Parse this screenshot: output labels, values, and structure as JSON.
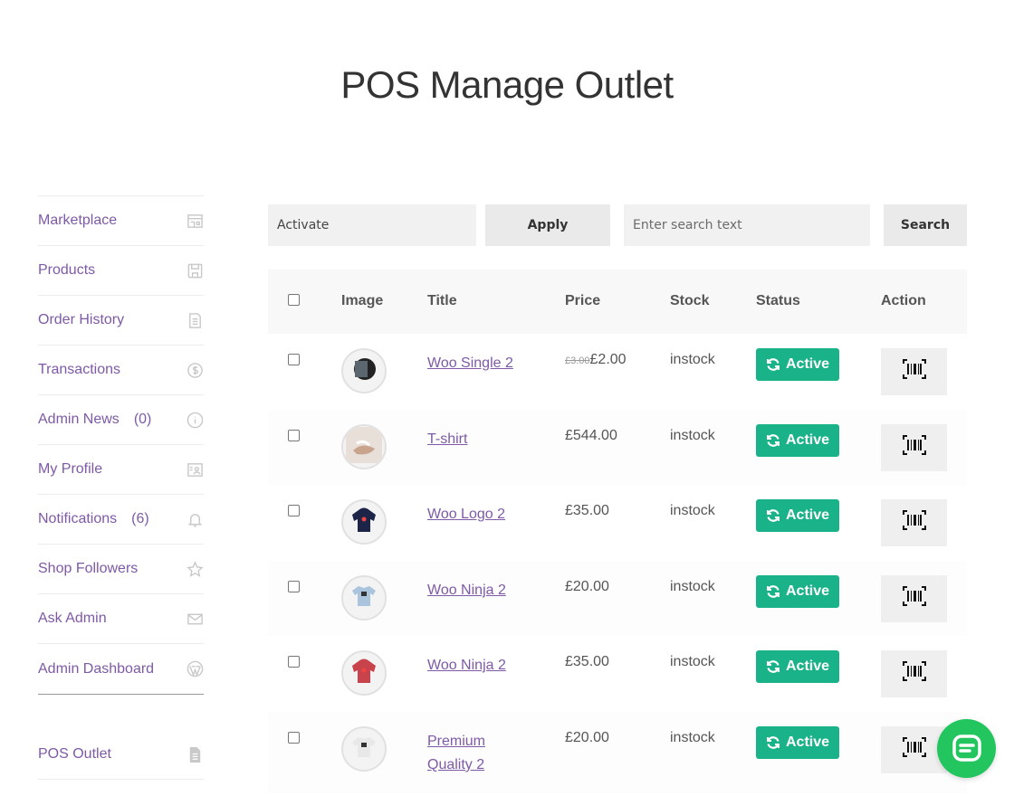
{
  "page": {
    "title": "POS Manage Outlet"
  },
  "sidebar": {
    "items": [
      {
        "label": "Marketplace",
        "count": "",
        "icon": "store-icon"
      },
      {
        "label": "Products",
        "count": "",
        "icon": "save-icon"
      },
      {
        "label": "Order History",
        "count": "",
        "icon": "document-icon"
      },
      {
        "label": "Transactions",
        "count": "",
        "icon": "dollar-icon"
      },
      {
        "label": "Admin News",
        "count": "(0)",
        "icon": "info-icon"
      },
      {
        "label": "My Profile",
        "count": "",
        "icon": "profile-card-icon"
      },
      {
        "label": "Notifications",
        "count": "(6)",
        "icon": "bell-icon"
      },
      {
        "label": "Shop Followers",
        "count": "",
        "icon": "star-icon"
      },
      {
        "label": "Ask Admin",
        "count": "",
        "icon": "mail-icon"
      },
      {
        "label": "Admin Dashboard",
        "count": "",
        "icon": "wordpress-icon"
      }
    ],
    "pos_items": [
      {
        "label": "POS Outlet",
        "icon": "file-icon"
      }
    ]
  },
  "toolbar": {
    "bulk_action_value": "Activate",
    "apply_label": "Apply",
    "search_placeholder": "Enter search text",
    "search_label": "Search"
  },
  "table": {
    "headers": {
      "image": "Image",
      "title": "Title",
      "price": "Price",
      "stock": "Stock",
      "status": "Status",
      "action": "Action"
    },
    "rows": [
      {
        "title": [
          "Woo Single 2"
        ],
        "old_price": "£3.00",
        "price": "£2.00",
        "stock": "instock",
        "status": "Active",
        "thumb": "album-icon"
      },
      {
        "title": [
          "T-shirt"
        ],
        "old_price": "",
        "price": "£544.00",
        "stock": "instock",
        "status": "Active",
        "thumb": "hand-icon"
      },
      {
        "title": [
          "Woo Logo 2"
        ],
        "old_price": "",
        "price": "£35.00",
        "stock": "instock",
        "status": "Active",
        "thumb": "hoodie-icon"
      },
      {
        "title": [
          "Woo Ninja 2"
        ],
        "old_price": "",
        "price": "£20.00",
        "stock": "instock",
        "status": "Active",
        "thumb": "tshirt-icon"
      },
      {
        "title": [
          "Woo Ninja 2"
        ],
        "old_price": "",
        "price": "£35.00",
        "stock": "instock",
        "status": "Active",
        "thumb": "hoodie-icon"
      },
      {
        "title": [
          "Premium",
          "Quality 2"
        ],
        "old_price": "",
        "price": "£20.00",
        "stock": "instock",
        "status": "Active",
        "thumb": "tshirt-icon"
      }
    ]
  },
  "colors": {
    "accent": "#7e5aa6",
    "status_active": "#1ab289",
    "chat": "#22c55e"
  }
}
